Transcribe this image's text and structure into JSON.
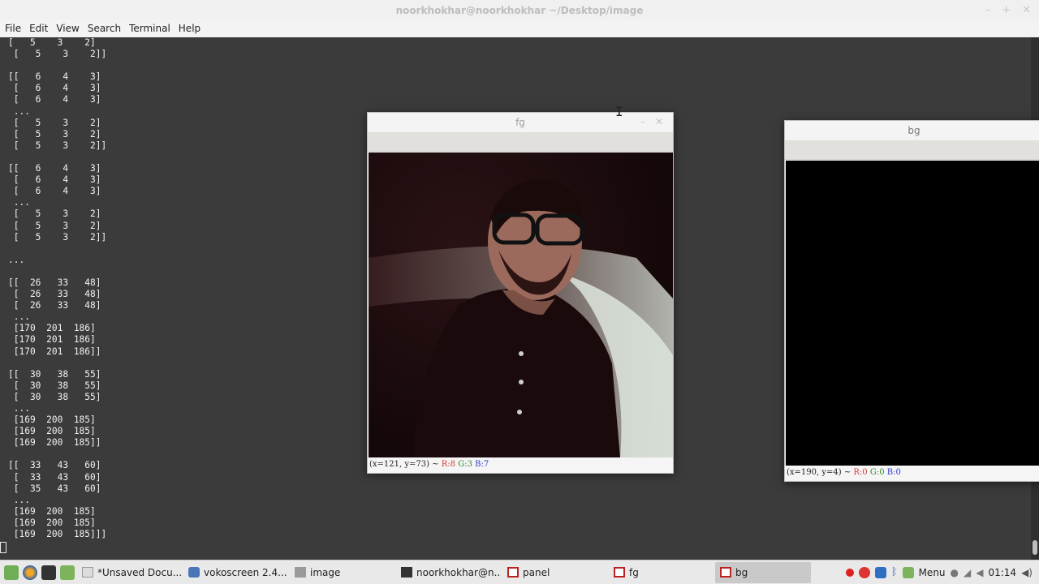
{
  "terminal": {
    "title": "noorkhokhar@noorkhokhar ~/Desktop/image",
    "menu": [
      "File",
      "Edit",
      "View",
      "Search",
      "Terminal",
      "Help"
    ],
    "output": "[   5    3    2]\n [   5    3    2]]\n\n[[   6    4    3]\n [   6    4    3]\n [   6    4    3]\n ...\n [   5    3    2]\n [   5    3    2]\n [   5    3    2]]\n\n[[   6    4    3]\n [   6    4    3]\n [   6    4    3]\n ...\n [   5    3    2]\n [   5    3    2]\n [   5    3    2]]\n\n...\n\n[[  26   33   48]\n [  26   33   48]\n [  26   33   48]\n ...\n [170  201  186]\n [170  201  186]\n [170  201  186]]\n\n[[  30   38   55]\n [  30   38   55]\n [  30   38   55]\n ...\n [169  200  185]\n [169  200  185]\n [169  200  185]]\n\n[[  33   43   60]\n [  33   43   60]\n [  35   43   60]\n ...\n [169  200  185]\n [169  200  185]\n [169  200  185]]]"
  },
  "fg_window": {
    "title": "fg",
    "status_coords": "(x=121, y=73) ~",
    "status_r": "R:8",
    "status_g": "G:3",
    "status_b": "B:7"
  },
  "bg_window": {
    "title": "bg",
    "status_coords": "(x=190, y=4) ~",
    "status_r": "R:0",
    "status_g": "G:0",
    "status_b": "B:0"
  },
  "taskbar": {
    "tasks": [
      {
        "label": "*Unsaved Docu...",
        "icon": "text-editor-icon"
      },
      {
        "label": "vokoscreen 2.4....",
        "icon": "vokoscreen-icon"
      },
      {
        "label": "image",
        "icon": "folder-icon"
      },
      {
        "label": "noorkhokhar@n...",
        "icon": "terminal-icon"
      },
      {
        "label": "panel",
        "icon": "window-icon"
      },
      {
        "label": "fg",
        "icon": "window-icon"
      },
      {
        "label": "bg",
        "icon": "window-icon"
      }
    ],
    "menu_label": "Menu",
    "clock": "01:14"
  }
}
